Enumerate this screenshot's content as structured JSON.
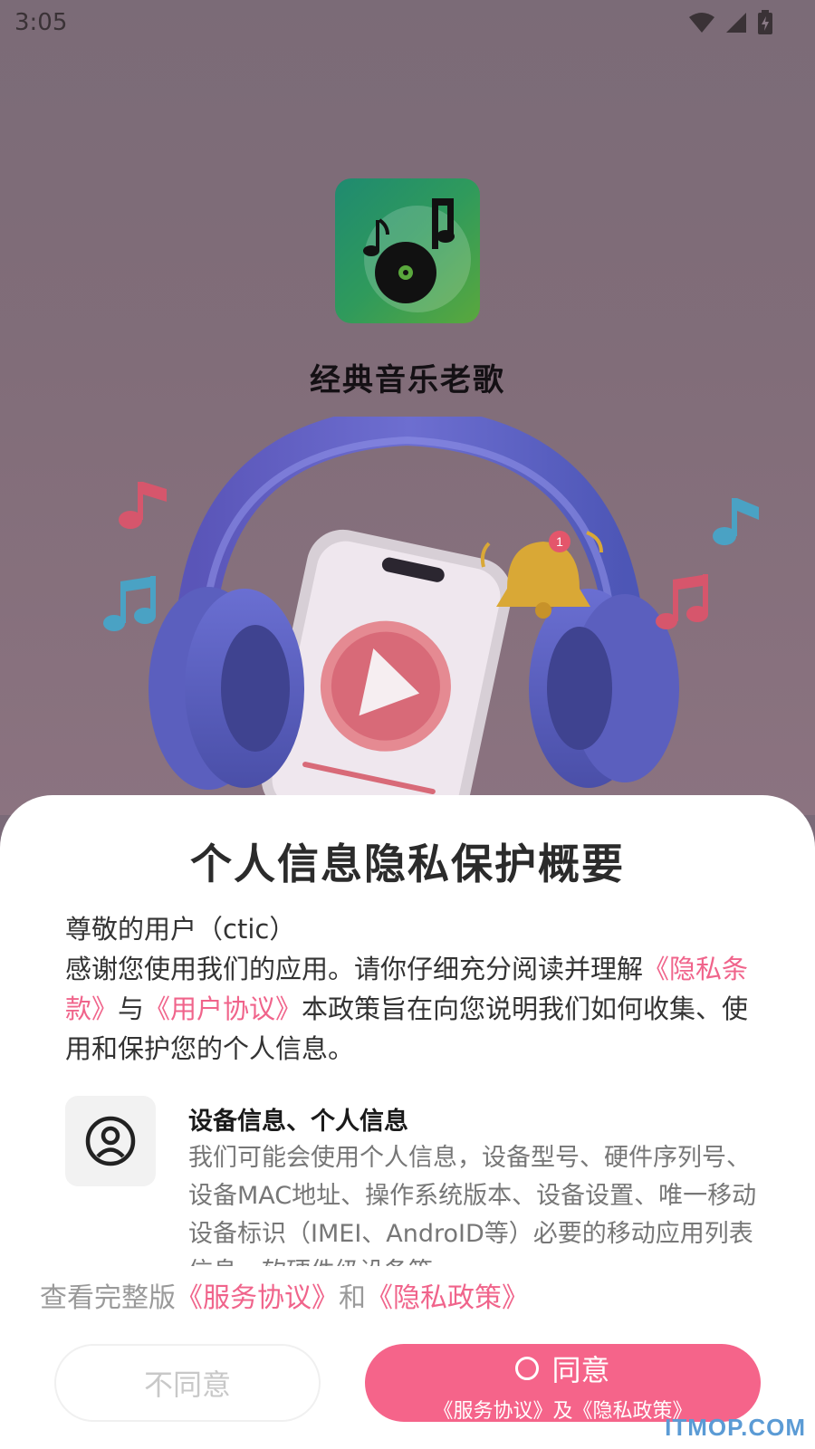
{
  "status_bar": {
    "time": "3:05"
  },
  "app": {
    "name": "经典音乐老歌"
  },
  "dialog": {
    "title": "个人信息隐私保护概要",
    "greeting": "尊敬的用户（ctic）",
    "intro_before": "感谢您使用我们的应用。请你仔细充分阅读并理解",
    "privacy_terms_link": "《隐私条款》",
    "and_word": "与",
    "user_agreement_link": "《用户协议》",
    "intro_after": "本政策旨在向您说明我们如何收集、使用和保护您的个人信息。",
    "item": {
      "title": "设备信息、个人信息",
      "description": "我们可能会使用个人信息，设备型号、硬件序列号、设备MAC地址、操作系统版本、设备设置、唯一移动设备标识（IMEI、AndroID等）必要的移动应用列表信息、软硬件级设备等",
      "icon": "user-circle-icon"
    },
    "footer_prefix": "查看完整版",
    "service_agreement_link": "《服务协议》",
    "footer_and": "和",
    "privacy_policy_link": "《隐私政策》",
    "disagree_label": "不同意",
    "agree_label": "同意",
    "agree_sublabel": "《服务协议》及《隐私政策》"
  },
  "watermark": "ITMOP.COM",
  "colors": {
    "accent": "#f5648a",
    "link": "#f0648b",
    "app_icon": "#2f9a5c"
  }
}
